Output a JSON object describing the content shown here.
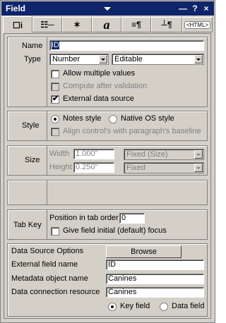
{
  "window": {
    "title": "Field",
    "min_label": "—",
    "help_label": "?",
    "close_label": "×"
  },
  "tabs": [
    {
      "name": "basics",
      "glyph": "☐i"
    },
    {
      "name": "control",
      "glyph": "☷─"
    },
    {
      "name": "hide",
      "glyph": "✶"
    },
    {
      "name": "font",
      "glyph": "a"
    },
    {
      "name": "paragraph",
      "glyph": "≡¶"
    },
    {
      "name": "paragraph-hide",
      "glyph": "┴¶"
    },
    {
      "name": "html",
      "glyph": "<HTML>"
    }
  ],
  "basics": {
    "name_label": "Name",
    "name_value": "ID",
    "type_label": "Type",
    "type_value": "Number",
    "mode_value": "Editable",
    "allow_multiple": {
      "label": "Allow multiple values",
      "checked": false
    },
    "compute_after": {
      "label": "Compute after validation",
      "checked": false,
      "disabled": true
    },
    "external_source": {
      "label": "External data source",
      "checked": true
    }
  },
  "style": {
    "label": "Style",
    "notes_style": "Notes style",
    "native_style": "Native OS style",
    "align_label": "Align control's with paragraph's baseline",
    "selected": "notes"
  },
  "size": {
    "label": "Size",
    "width_label": "Width",
    "width_value": "1.000\"",
    "width_mode": "Fixed (Size)",
    "height_label": "Height",
    "height_value": "0.250\"",
    "height_mode": "Fixed"
  },
  "tab_key": {
    "label": "Tab Key",
    "position_label": "Position in tab order",
    "position_value": "0",
    "initial_focus": {
      "label": "Give field initial (default) focus",
      "checked": false
    }
  },
  "data_source": {
    "label": "Data Source Options",
    "browse_label": "Browse",
    "external_field_label": "External field name",
    "external_field_value": "ID",
    "metadata_label": "Metadata object name",
    "metadata_value": "Canines",
    "connection_label": "Data connection resource",
    "connection_value": "Canines",
    "key_field": "Key field",
    "data_field": "Data field",
    "selected": "key"
  }
}
